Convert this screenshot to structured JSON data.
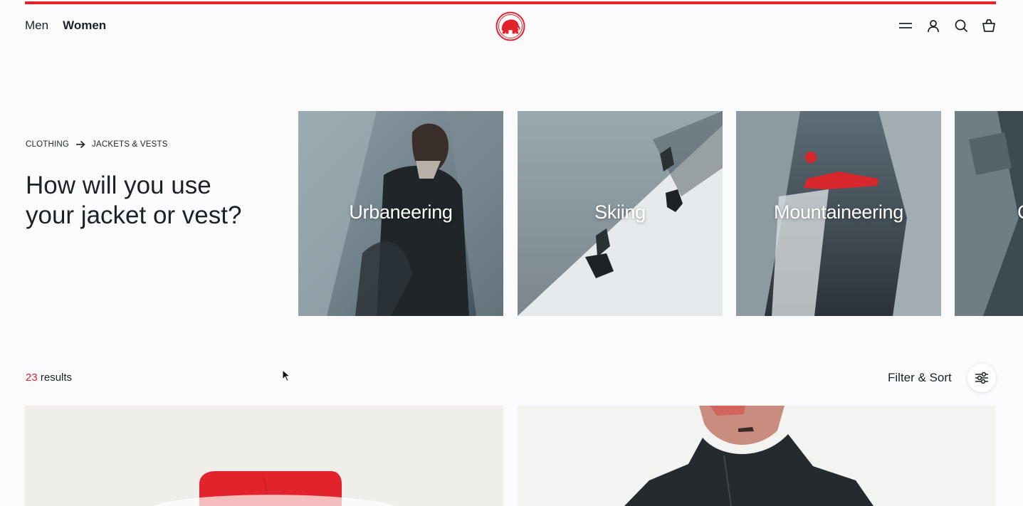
{
  "header": {
    "nav": [
      {
        "label": "Men"
      },
      {
        "label": "Women"
      }
    ],
    "brand_color": "#e2232b",
    "icons": [
      "menu-icon",
      "account-icon",
      "search-icon",
      "cart-icon"
    ]
  },
  "breadcrumb": {
    "items": [
      "CLOTHING",
      "JACKETS & VESTS"
    ]
  },
  "hero": {
    "title": "How will you use your jacket or vest?"
  },
  "activities": [
    {
      "label": "Urbaneering"
    },
    {
      "label": "Skiing"
    },
    {
      "label": "Mountaineering"
    },
    {
      "label": "C"
    }
  ],
  "results": {
    "count": "23",
    "suffix": " results"
  },
  "filter": {
    "label": "Filter & Sort"
  }
}
